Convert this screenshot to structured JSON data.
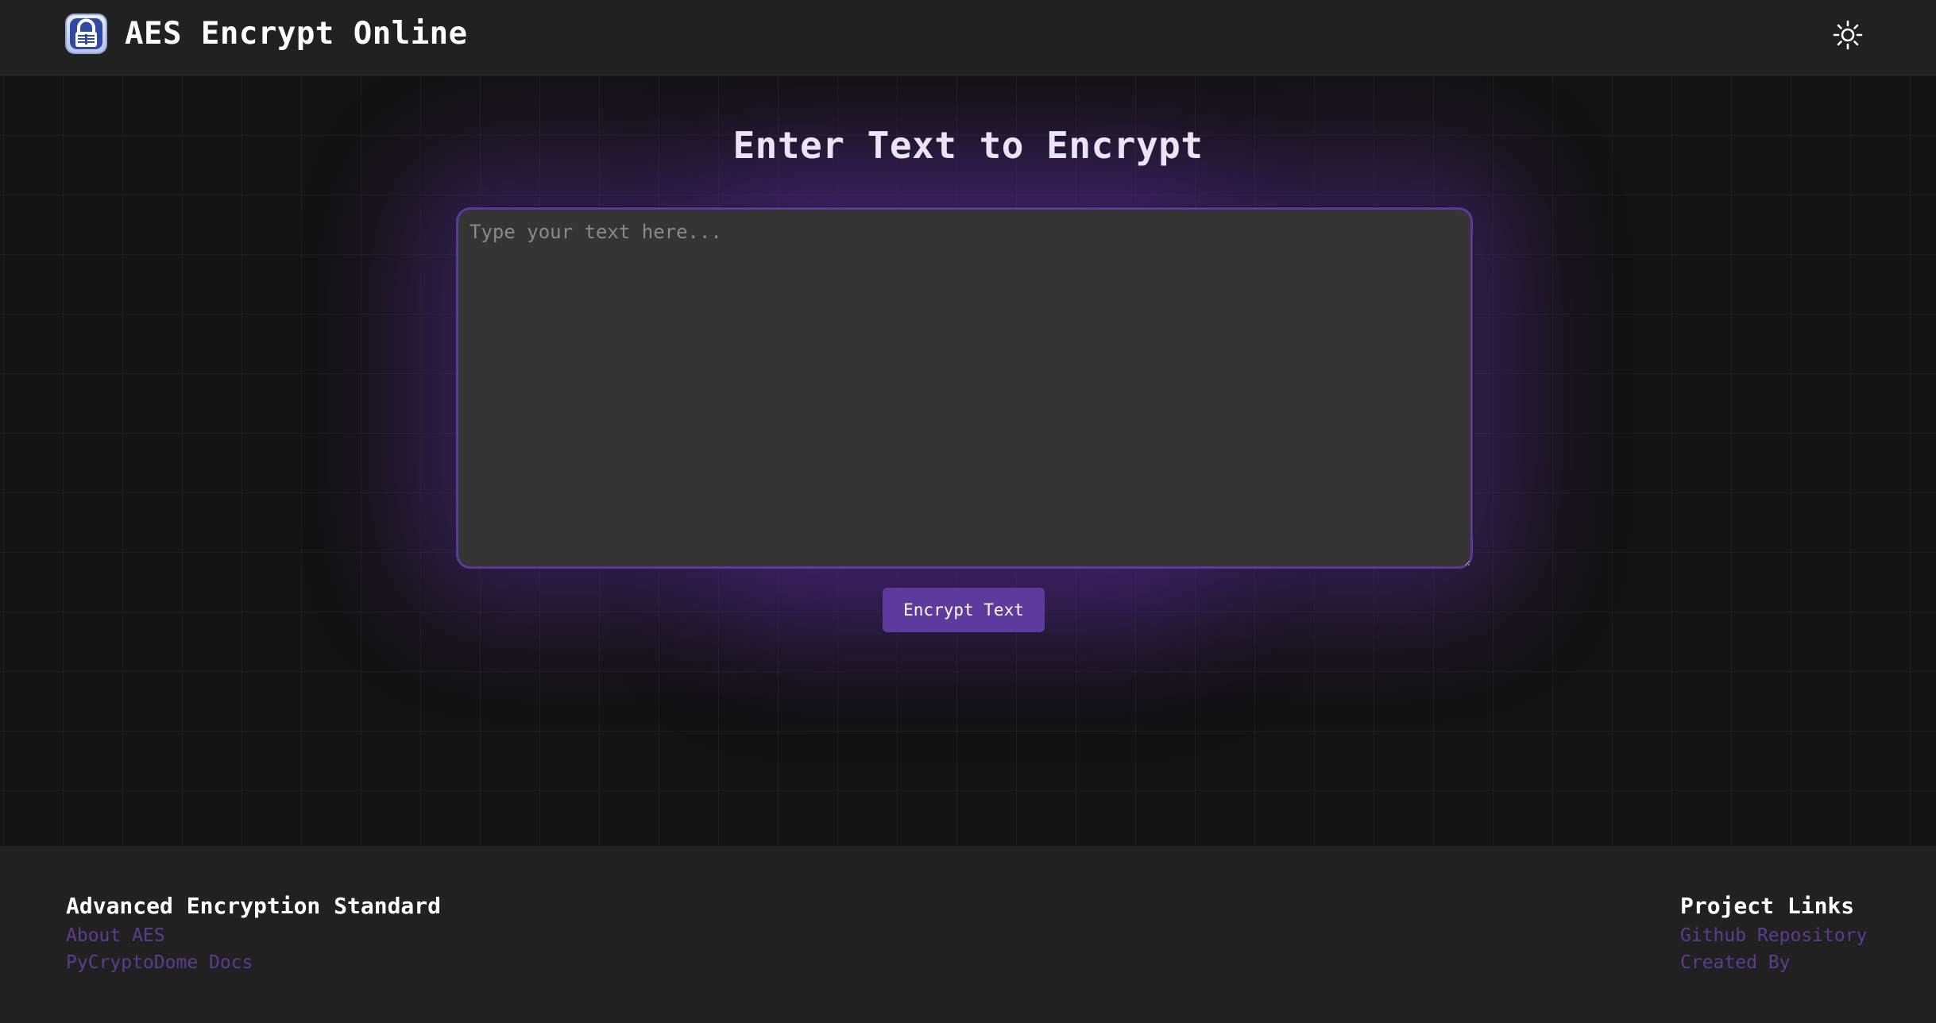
{
  "header": {
    "title": "AES Encrypt Online",
    "logo_icon": "padlock-logo-icon",
    "theme_toggle_icon": "sun-icon"
  },
  "main": {
    "heading": "Enter Text to Encrypt",
    "input": {
      "placeholder": "Type your text here...",
      "value": ""
    },
    "encrypt_button_label": "Encrypt Text"
  },
  "footer": {
    "left": {
      "heading": "Advanced Encryption Standard",
      "links": [
        "About AES",
        "PyCryptoDome Docs"
      ]
    },
    "right": {
      "heading": "Project Links",
      "links": [
        "Github Repository",
        "Created By"
      ]
    }
  },
  "colors": {
    "accent": "#5e3a9e",
    "link": "#5a3d8f",
    "background": "#131313",
    "header_footer": "#212121",
    "input_background": "#353535"
  }
}
